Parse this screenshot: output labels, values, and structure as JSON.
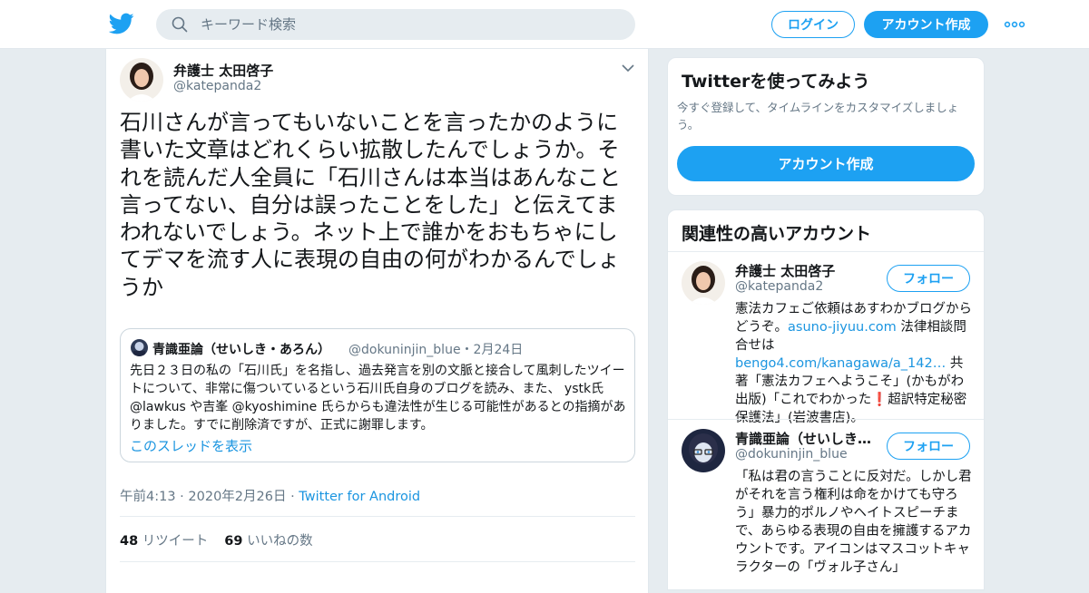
{
  "header": {
    "search_placeholder": "キーワード検索",
    "login": "ログイン",
    "signup": "アカウント作成"
  },
  "tweet": {
    "name": "弁護士 太田啓子",
    "handle": "@katepanda2",
    "text": "石川さんが言ってもいないことを言ったかのように書いた文章はどれくらい拡散したんでしょうか。それを読んだ人全員に「石川さんは本当はあんなこと言ってない、自分は誤ったことをした」と伝えてまわれないでしょう。ネット上で誰かをおもちゃにしてデマを流す人に表現の自由の何がわかるんでしょうか",
    "quote": {
      "name": "青識亜論（せいしき・あろん）",
      "meta": "@dokuninjin_blue・2月24日",
      "text": "先日２３日の私の「石川氏」を名指し、過去発言を別の文脈と接合して風刺したツイートについて、非常に傷ついているという石川氏自身のブログを読み、また、 ystk氏 @lawkus や吉峯 @kyoshimine 氏らからも違法性が生じる可能性があるとの指摘がありました。すでに削除済ですが、正式に謝罪します。",
      "link": "このスレッドを表示"
    },
    "time": "午前4:13 · 2020年2月26日 · ",
    "source": "Twitter for Android",
    "retweets_count": "48",
    "retweets_label": "リツイート",
    "likes_count": "69",
    "likes_label": "いいねの数"
  },
  "sidebar": {
    "promo_title": "Twitterを使ってみよう",
    "promo_sub": "今すぐ登録して、タイムラインをカスタマイズしましょう。",
    "promo_button": "アカウント作成",
    "related_title": "関連性の高いアカウント",
    "follow_label": "フォロー",
    "accounts": [
      {
        "name": "弁護士 太田啓子",
        "handle": "@katepanda2",
        "bio_a": "憲法カフェご依頼はあすわかブログからどうぞ。",
        "bio_link1": "asuno-jiyuu.com",
        "bio_b": " 法律相談問合せは",
        "bio_link2": "bengo4.com/kanagawa/a_142…",
        "bio_c": " 共著「憲法カフェへようこそ」(かもがわ出版)「これでわかった❗️超訳特定秘密保護法」(岩波書店)。"
      },
      {
        "name": "青識亜論（せいしき・あろん）",
        "handle": "@dokuninjin_blue",
        "bio": "「私は君の言うことに反対だ。しかし君がそれを言う権利は命をかけても守ろう」暴力的ポルノやヘイトスピーチまで、あらゆる表現の自由を擁護するアカウントです。アイコンはマスコットキャラクターの「ヴォル子さん」"
      }
    ]
  }
}
